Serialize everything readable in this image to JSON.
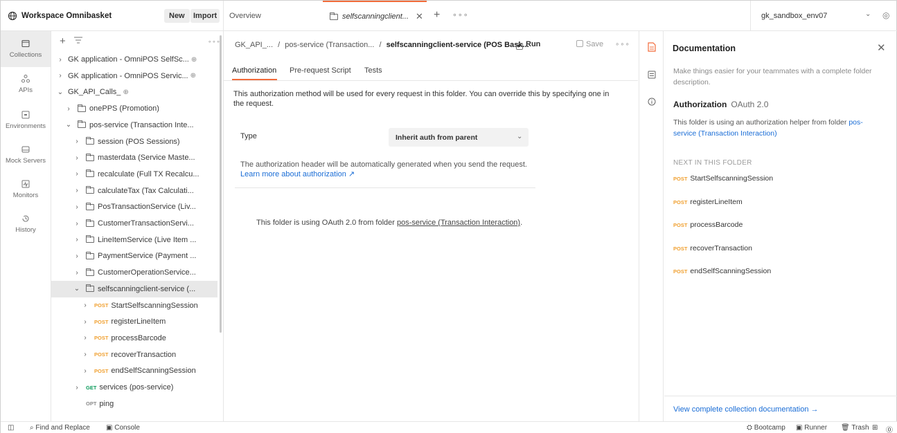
{
  "workspace": {
    "title": "Workspace Omnibasket",
    "new_label": "New",
    "import_label": "Import"
  },
  "nav": [
    {
      "label": "Collections",
      "icon": "collections-icon"
    },
    {
      "label": "APIs",
      "icon": "apis-icon"
    },
    {
      "label": "Environments",
      "icon": "environments-icon"
    },
    {
      "label": "Mock Servers",
      "icon": "mock-servers-icon"
    },
    {
      "label": "Monitors",
      "icon": "monitors-icon"
    },
    {
      "label": "History",
      "icon": "history-icon"
    }
  ],
  "tree": [
    {
      "indent": 0,
      "chevron": "›",
      "folder": false,
      "text": "GK application - OmniPOS SelfSc...",
      "globe": true
    },
    {
      "indent": 0,
      "chevron": "›",
      "folder": false,
      "text": "GK application - OmniPOS Servic...",
      "globe": true
    },
    {
      "indent": 0,
      "chevron": "⌄",
      "folder": false,
      "text": "GK_API_Calls_",
      "globe": true
    },
    {
      "indent": 1,
      "chevron": "›",
      "folder": true,
      "text": "onePPS (Promotion)"
    },
    {
      "indent": 1,
      "chevron": "⌄",
      "folder": true,
      "text": "pos-service (Transaction Inte..."
    },
    {
      "indent": 2,
      "chevron": "›",
      "folder": true,
      "text": "session (POS Sessions)"
    },
    {
      "indent": 2,
      "chevron": "›",
      "folder": true,
      "text": "masterdata (Service Maste..."
    },
    {
      "indent": 2,
      "chevron": "›",
      "folder": true,
      "text": "recalculate (Full TX Recalcu..."
    },
    {
      "indent": 2,
      "chevron": "›",
      "folder": true,
      "text": "calculateTax (Tax Calculati..."
    },
    {
      "indent": 2,
      "chevron": "›",
      "folder": true,
      "text": "PosTransactionService (Liv..."
    },
    {
      "indent": 2,
      "chevron": "›",
      "folder": true,
      "text": "CustomerTransactionServi..."
    },
    {
      "indent": 2,
      "chevron": "›",
      "folder": true,
      "text": "LineItemService (Live Item ..."
    },
    {
      "indent": 2,
      "chevron": "›",
      "folder": true,
      "text": "PaymentService (Payment ..."
    },
    {
      "indent": 2,
      "chevron": "›",
      "folder": true,
      "text": "CustomerOperationService..."
    },
    {
      "indent": 2,
      "chevron": "⌄",
      "folder": true,
      "text": "selfscanningclient-service (...",
      "selected": true
    },
    {
      "indent": 3,
      "chevron": "›",
      "method": "POST",
      "text": "StartSelfscanningSession"
    },
    {
      "indent": 3,
      "chevron": "›",
      "method": "POST",
      "text": "registerLineItem"
    },
    {
      "indent": 3,
      "chevron": "›",
      "method": "POST",
      "text": "processBarcode"
    },
    {
      "indent": 3,
      "chevron": "›",
      "method": "POST",
      "text": "recoverTransaction"
    },
    {
      "indent": 3,
      "chevron": "›",
      "method": "POST",
      "text": "endSelfScanningSession"
    },
    {
      "indent": 2,
      "chevron": "›",
      "method": "GET",
      "text": "services (pos-service)"
    },
    {
      "indent": 2,
      "chevron": "",
      "method": "OPT",
      "text": "ping"
    }
  ],
  "tabs": {
    "overview": "Overview",
    "active": "selfscanningclient...",
    "plus": "+",
    "more": "∘∘∘"
  },
  "environment": {
    "name": "gk_sandbox_env07"
  },
  "breadcrumb": {
    "part1": "GK_API_...",
    "sep": "/",
    "part2": "pos-service (Transaction...",
    "part3": "selfscanningclient-service (POS Bask...",
    "run_label": "Run",
    "save_label": "Save",
    "more": "∘∘∘"
  },
  "subtabs": [
    "Authorization",
    "Pre-request Script",
    "Tests"
  ],
  "auth": {
    "description": "This authorization method will be used for every request in this folder. You can override this by specifying one in the request.",
    "type_label": "Type",
    "type_value": "Inherit auth from parent",
    "note": "The authorization header will be automatically generated when you send the request.",
    "learn_more": "Learn more about authorization ↗",
    "oauth_prefix": "This folder is using OAuth 2.0 from folder ",
    "oauth_link": "pos-service (Transaction Interaction)",
    "oauth_suffix": "."
  },
  "documentation": {
    "title": "Documentation",
    "description": "Make things easier for your teammates with a complete folder description.",
    "auth_title": "Authorization",
    "auth_type": "OAuth 2.0",
    "auth_desc_prefix": "This folder is using an authorization helper from folder ",
    "auth_desc_link": "pos-service (Transaction Interaction)",
    "next_label": "NEXT IN THIS FOLDER",
    "next_items": [
      {
        "method": "POST",
        "name": "StartSelfscanningSession"
      },
      {
        "method": "POST",
        "name": "registerLineItem"
      },
      {
        "method": "POST",
        "name": "processBarcode"
      },
      {
        "method": "POST",
        "name": "recoverTransaction"
      },
      {
        "method": "POST",
        "name": "endSelfScanningSession"
      }
    ],
    "footer_link": "View complete collection documentation →"
  },
  "status": {
    "find_replace": "Find and Replace",
    "console": "Console",
    "bootcamp": "Bootcamp",
    "runner": "Runner",
    "trash": "Trash"
  },
  "colors": {
    "accent": "#f26b3a",
    "link": "#1a6dd6",
    "post": "#f0a030",
    "get": "#0a9a5a"
  }
}
